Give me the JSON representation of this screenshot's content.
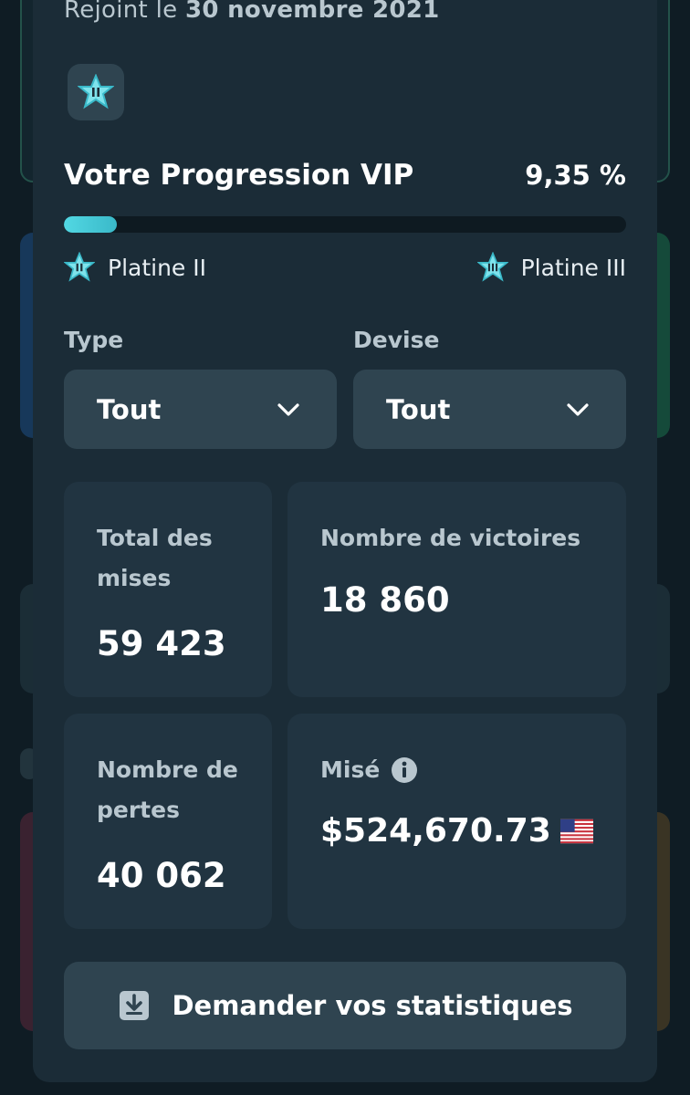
{
  "profile": {
    "joined_prefix": "Rejoint le",
    "joined_date": "30 novembre 2021",
    "badge_icon": "platinum-star-ii-icon"
  },
  "vip": {
    "title": "Votre Progression VIP",
    "percent_label": "9,35 %",
    "progress_fraction": 0.0935,
    "current_level": "Platine II",
    "next_level": "Platine III"
  },
  "filters": {
    "type_label": "Type",
    "type_value": "Tout",
    "currency_label": "Devise",
    "currency_value": "Tout"
  },
  "stats": {
    "total_bets_label": "Total des mises",
    "total_bets_value": "59 423",
    "wins_label": "Nombre de victoires",
    "wins_value": "18 860",
    "losses_label": "Nombre de pertes",
    "losses_value": "40 062",
    "wagered_label": "Misé",
    "wagered_value": "$524,670.73",
    "wagered_currency_icon": "us-flag-icon"
  },
  "actions": {
    "request_stats_label": "Demander vos statistiques"
  },
  "colors": {
    "accent": "#52d8e3",
    "panel": "#1b2c37",
    "card": "#213441",
    "control": "#2f4450"
  }
}
